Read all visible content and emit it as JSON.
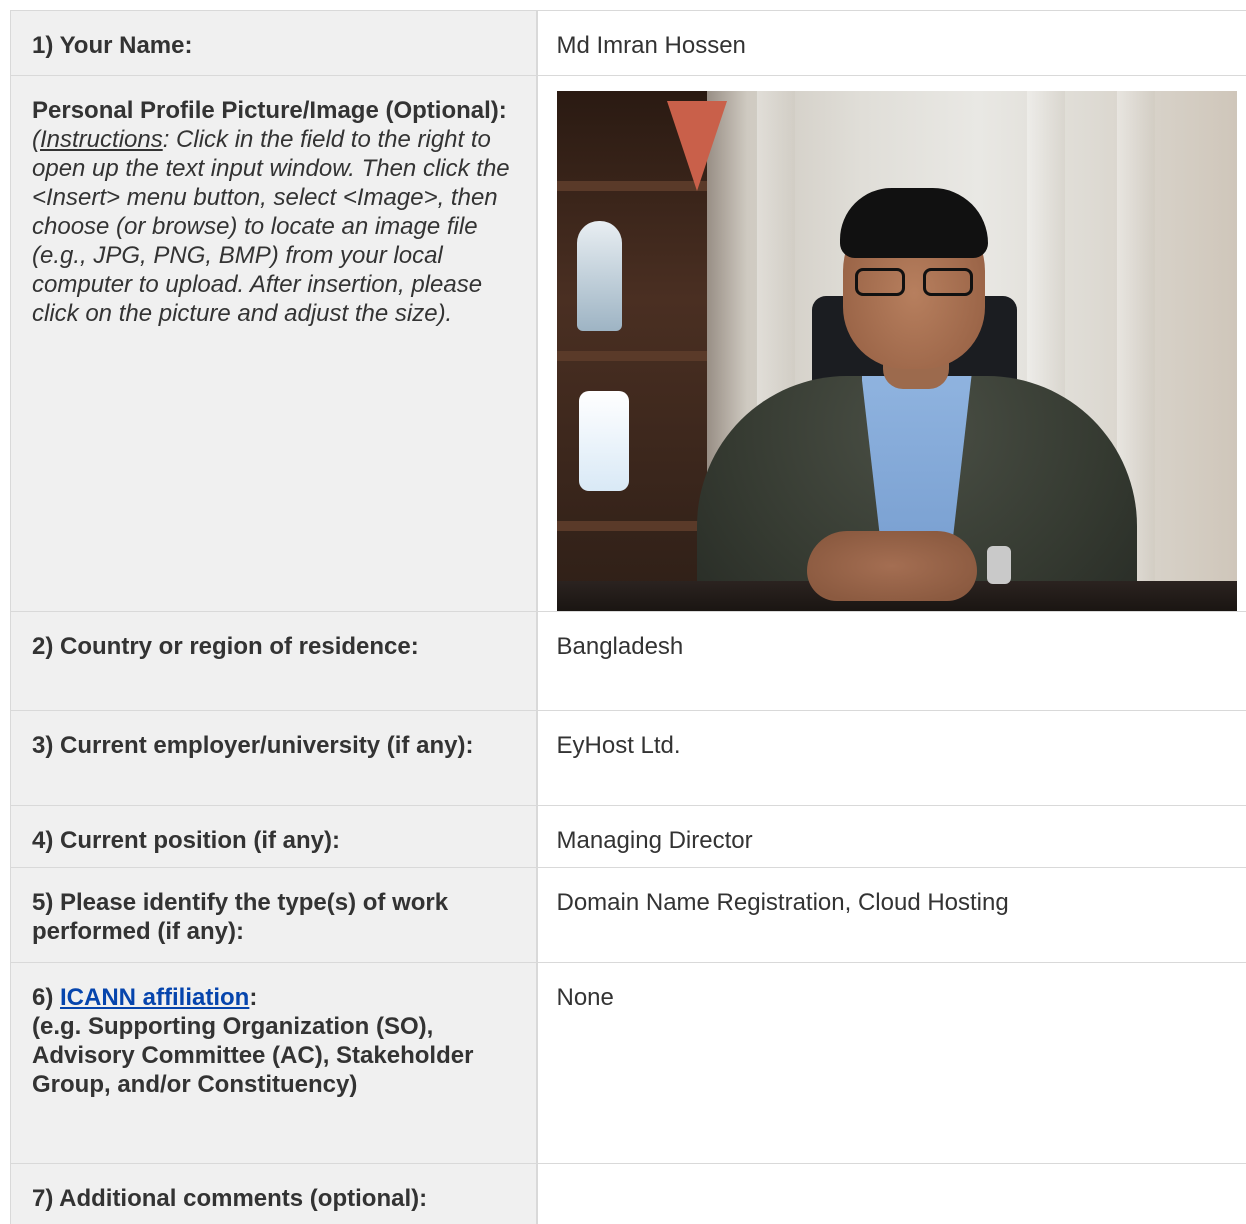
{
  "rows": [
    {
      "label": "1) Your Name:",
      "value": "Md Imran Hossen"
    },
    {
      "label": "Personal Profile Picture/Image (Optional):",
      "instructions_prefix": "(",
      "instructions_word": "Instructions",
      "instructions_text": ": Click in the field to the right to open up the text input window. Then click the <Insert> menu button, select <Image>, then choose (or browse) to locate an image file (e.g., JPG, PNG, BMP) from your local computer to upload. After insertion, please click on the picture and adjust the size)."
    },
    {
      "label": "2) Country or region of residence:",
      "value": "Bangladesh"
    },
    {
      "label": "3) Current employer/university (if any):",
      "value": "EyHost Ltd."
    },
    {
      "label": "4) Current position (if any):",
      "value": "Managing Director"
    },
    {
      "label": "5) Please identify the type(s) of work performed (if any):",
      "value": "Domain Name Registration, Cloud Hosting"
    },
    {
      "label_prefix": "6) ",
      "label_link": "ICANN affiliation",
      "label_suffix": ":",
      "label_detail": "(e.g. Supporting Organization (SO), Advisory Committee (AC), Stakeholder Group, and/or Constituency)",
      "value": "None"
    },
    {
      "label": "7) Additional comments (optional):",
      "value": ""
    }
  ],
  "colors": {
    "label_background": "#f0f0f0",
    "border": "#d9d9d9",
    "link": "#0645ad",
    "text": "#333333"
  }
}
